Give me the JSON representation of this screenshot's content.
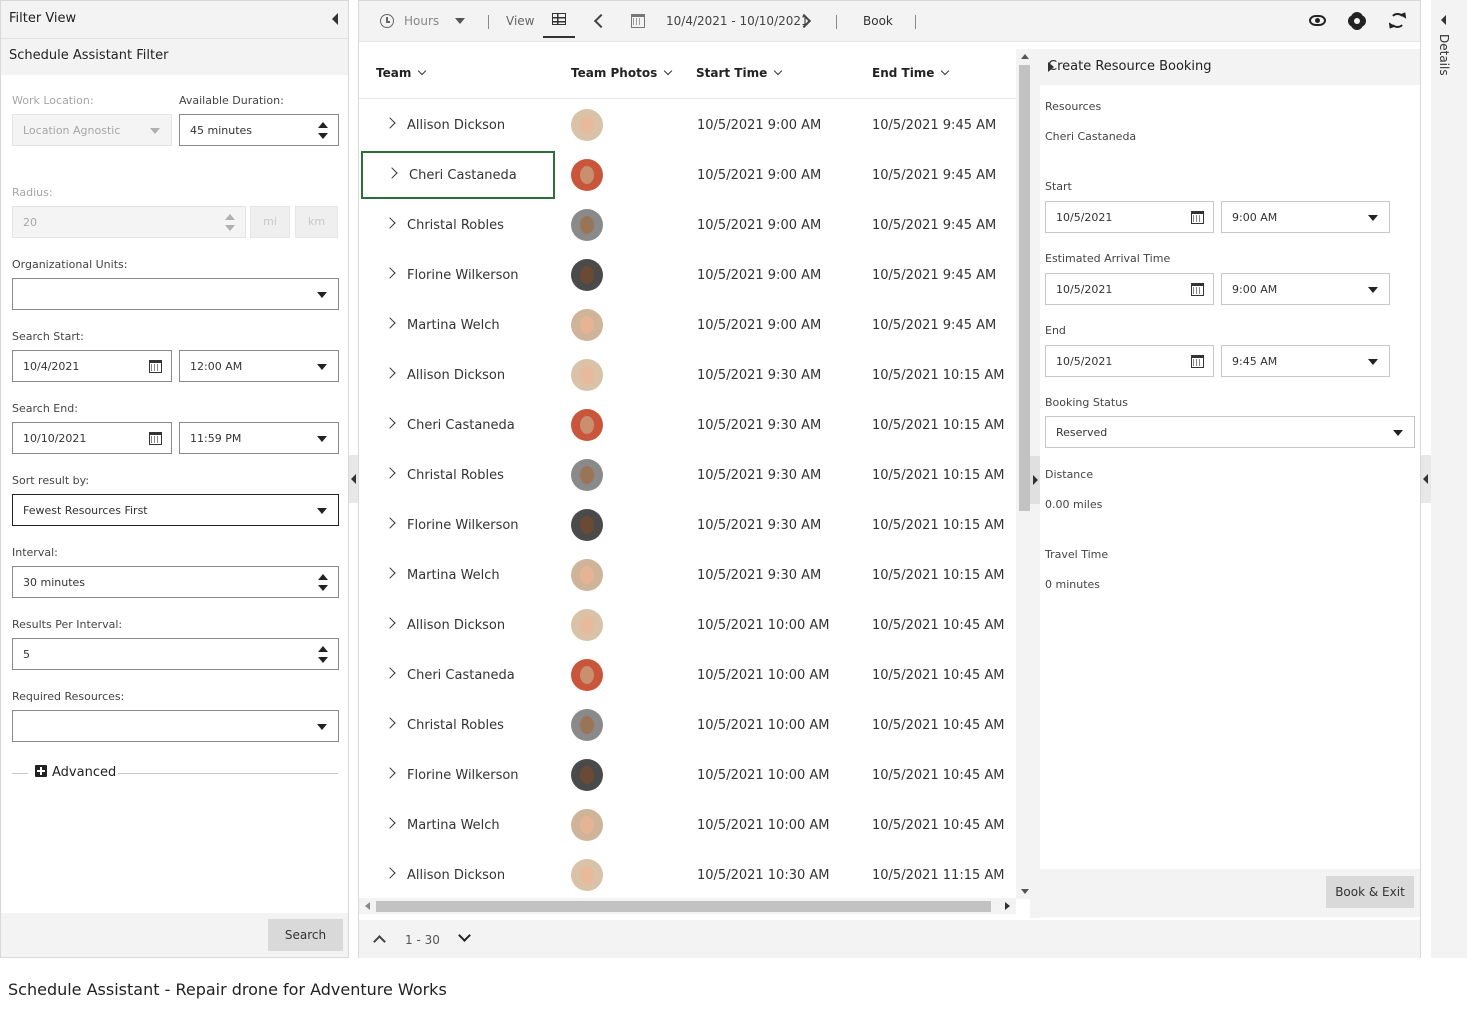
{
  "filter": {
    "header_title": "Filter View",
    "subtitle": "Schedule Assistant Filter",
    "work_location": {
      "label": "Work Location:",
      "value": "Location Agnostic"
    },
    "available_duration": {
      "label": "Available Duration:",
      "value": "45 minutes"
    },
    "radius": {
      "label": "Radius:",
      "value": "20",
      "unit_mi": "mi",
      "unit_km": "km"
    },
    "org_units": {
      "label": "Organizational Units:",
      "value": ""
    },
    "search_start": {
      "label": "Search Start:",
      "date": "10/4/2021",
      "time": "12:00 AM"
    },
    "search_end": {
      "label": "Search End:",
      "date": "10/10/2021",
      "time": "11:59 PM"
    },
    "sort_by": {
      "label": "Sort result by:",
      "value": "Fewest Resources First"
    },
    "interval": {
      "label": "Interval:",
      "value": "30 minutes"
    },
    "results_per_interval": {
      "label": "Results Per Interval:",
      "value": "5"
    },
    "required_resources": {
      "label": "Required Resources:",
      "value": ""
    },
    "advanced_label": "Advanced",
    "search_button": "Search"
  },
  "toolbar": {
    "hours_label": "Hours",
    "view_label": "View",
    "date_range": "10/4/2021 - 10/10/2021",
    "book_label": "Book"
  },
  "grid": {
    "columns": [
      "Team",
      "Team Photos",
      "Start Time",
      "End Time"
    ],
    "rows": [
      {
        "team": "Allison Dickson",
        "start": "10/5/2021 9:00 AM",
        "end": "10/5/2021 9:45 AM"
      },
      {
        "team": "Cheri Castaneda",
        "start": "10/5/2021 9:00 AM",
        "end": "10/5/2021 9:45 AM"
      },
      {
        "team": "Christal Robles",
        "start": "10/5/2021 9:00 AM",
        "end": "10/5/2021 9:45 AM"
      },
      {
        "team": "Florine Wilkerson",
        "start": "10/5/2021 9:00 AM",
        "end": "10/5/2021 9:45 AM"
      },
      {
        "team": "Martina Welch",
        "start": "10/5/2021 9:00 AM",
        "end": "10/5/2021 9:45 AM"
      },
      {
        "team": "Allison Dickson",
        "start": "10/5/2021 9:30 AM",
        "end": "10/5/2021 10:15 AM"
      },
      {
        "team": "Cheri Castaneda",
        "start": "10/5/2021 9:30 AM",
        "end": "10/5/2021 10:15 AM"
      },
      {
        "team": "Christal Robles",
        "start": "10/5/2021 9:30 AM",
        "end": "10/5/2021 10:15 AM"
      },
      {
        "team": "Florine Wilkerson",
        "start": "10/5/2021 9:30 AM",
        "end": "10/5/2021 10:15 AM"
      },
      {
        "team": "Martina Welch",
        "start": "10/5/2021 9:30 AM",
        "end": "10/5/2021 10:15 AM"
      },
      {
        "team": "Allison Dickson",
        "start": "10/5/2021 10:00 AM",
        "end": "10/5/2021 10:45 AM"
      },
      {
        "team": "Cheri Castaneda",
        "start": "10/5/2021 10:00 AM",
        "end": "10/5/2021 10:45 AM"
      },
      {
        "team": "Christal Robles",
        "start": "10/5/2021 10:00 AM",
        "end": "10/5/2021 10:45 AM"
      },
      {
        "team": "Florine Wilkerson",
        "start": "10/5/2021 10:00 AM",
        "end": "10/5/2021 10:45 AM"
      },
      {
        "team": "Martina Welch",
        "start": "10/5/2021 10:00 AM",
        "end": "10/5/2021 10:45 AM"
      },
      {
        "team": "Allison Dickson",
        "start": "10/5/2021 10:30 AM",
        "end": "10/5/2021 11:15 AM"
      }
    ],
    "selected_row": 1
  },
  "pager": {
    "range": "1 - 30"
  },
  "booking": {
    "title": "Create Resource Booking",
    "resources_label": "Resources",
    "resources_value": "Cheri Castaneda",
    "start": {
      "label": "Start",
      "date": "10/5/2021",
      "time": "9:00 AM"
    },
    "arrival": {
      "label": "Estimated Arrival Time",
      "date": "10/5/2021",
      "time": "9:00 AM"
    },
    "end": {
      "label": "End",
      "date": "10/5/2021",
      "time": "9:45 AM"
    },
    "status": {
      "label": "Booking Status",
      "value": "Reserved"
    },
    "distance": {
      "label": "Distance",
      "value": "0.00 miles"
    },
    "travel": {
      "label": "Travel Time",
      "value": "0 minutes"
    },
    "book_exit_button": "Book & Exit"
  },
  "details_rail": {
    "label": "Details"
  },
  "caption": "Schedule Assistant - Repair drone for Adventure Works"
}
